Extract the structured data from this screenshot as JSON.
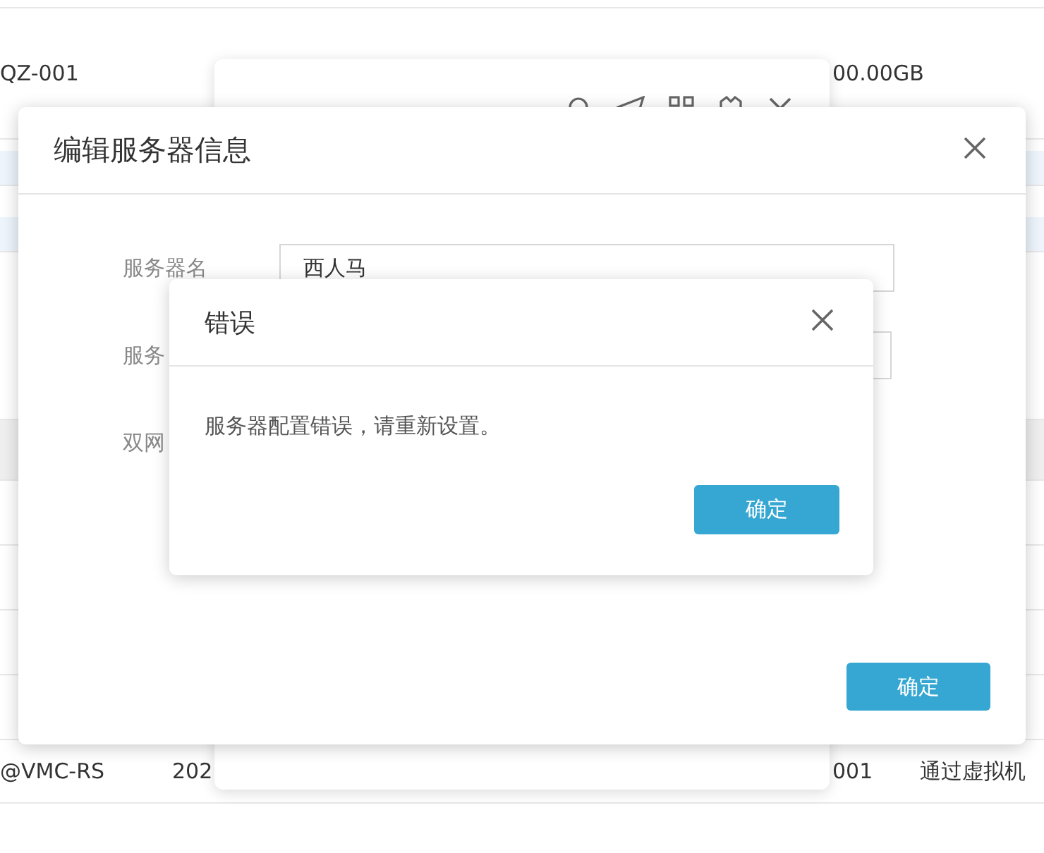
{
  "background_table": {
    "rows": [
      {
        "column_1": "QZ-001",
        "column_3": "00.00GB"
      },
      {
        "column_1": "@VMC-RS",
        "column_2": "202",
        "column_3": "001",
        "column_4": "通过虚拟机"
      }
    ]
  },
  "edit_dialog": {
    "title": "编辑服务器信息",
    "fields": [
      {
        "label": "服务器名",
        "value": "西人马"
      },
      {
        "label": "服务"
      },
      {
        "label": "双网"
      }
    ],
    "confirm_button": "确定"
  },
  "error_dialog": {
    "title": "错误",
    "message": "服务器配置错误，请重新设置。",
    "confirm_button": "确定"
  }
}
